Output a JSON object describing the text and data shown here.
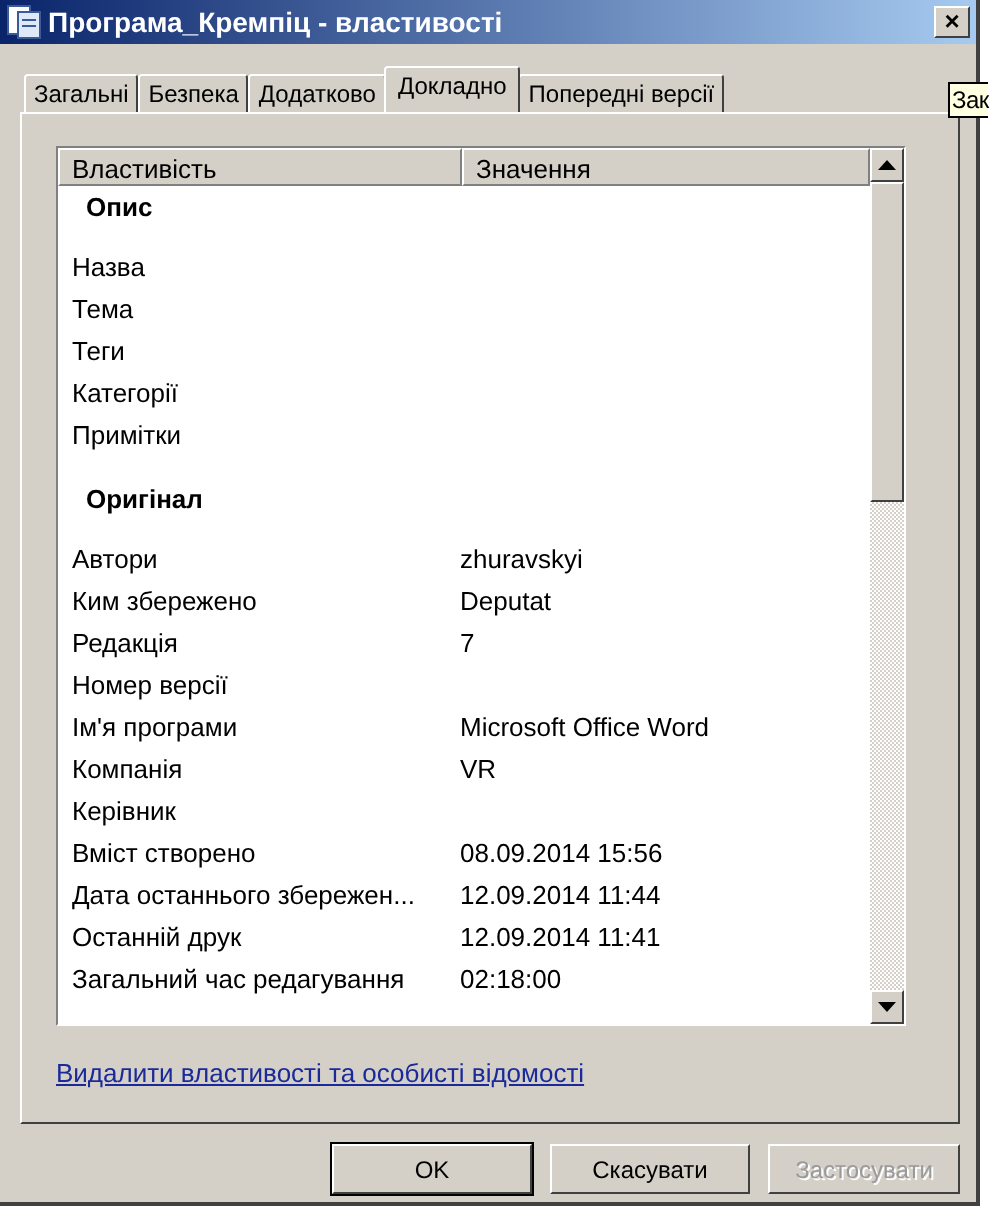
{
  "window": {
    "title": "Програма_Кремпіц - властивості",
    "close": "×"
  },
  "tooltip": "Зак",
  "tabs": [
    {
      "label": "Загальні",
      "selected": false
    },
    {
      "label": "Безпека",
      "selected": false
    },
    {
      "label": "Додатково",
      "selected": false
    },
    {
      "label": "Докладно",
      "selected": true
    },
    {
      "label": "Попередні версії",
      "selected": false
    }
  ],
  "table": {
    "columns": [
      "Властивість",
      "Значення"
    ],
    "rows": [
      {
        "kind": "group",
        "name": "Опис"
      },
      {
        "kind": "property",
        "name": "Назва"
      },
      {
        "kind": "property",
        "name": "Тема"
      },
      {
        "kind": "property",
        "name": "Теги"
      },
      {
        "kind": "property",
        "name": "Категорії"
      },
      {
        "kind": "property",
        "name": "Примітки"
      },
      {
        "kind": "group",
        "name": "Оригінал"
      },
      {
        "kind": "property",
        "name": "Автори",
        "value": "zhuravskyi"
      },
      {
        "kind": "property",
        "name": "Ким збережено",
        "value": "Deputat"
      },
      {
        "kind": "property",
        "name": "Редакція",
        "value": "7"
      },
      {
        "kind": "property",
        "name": "Номер версії"
      },
      {
        "kind": "property",
        "name": "Ім'я програми",
        "value": "Microsoft Office Word"
      },
      {
        "kind": "property",
        "name": "Компанія",
        "value": "VR"
      },
      {
        "kind": "property",
        "name": "Керівник"
      },
      {
        "kind": "property",
        "name": "Вміст створено",
        "value": "08.09.2014 15:56"
      },
      {
        "kind": "property",
        "name": "Дата останнього збережен...",
        "value": "12.09.2014 11:44"
      },
      {
        "kind": "property",
        "name": "Останній друк",
        "value": "12.09.2014 11:41"
      },
      {
        "kind": "property",
        "name": "Загальний час редагування",
        "value": "02:18:00"
      }
    ]
  },
  "link": "Видалити властивості та особисті відомості",
  "buttons": [
    {
      "label": "OK",
      "default": true,
      "disabled": false
    },
    {
      "label": "Скасувати",
      "default": false,
      "disabled": false
    },
    {
      "label": "Застосувати",
      "default": false,
      "disabled": true
    }
  ]
}
